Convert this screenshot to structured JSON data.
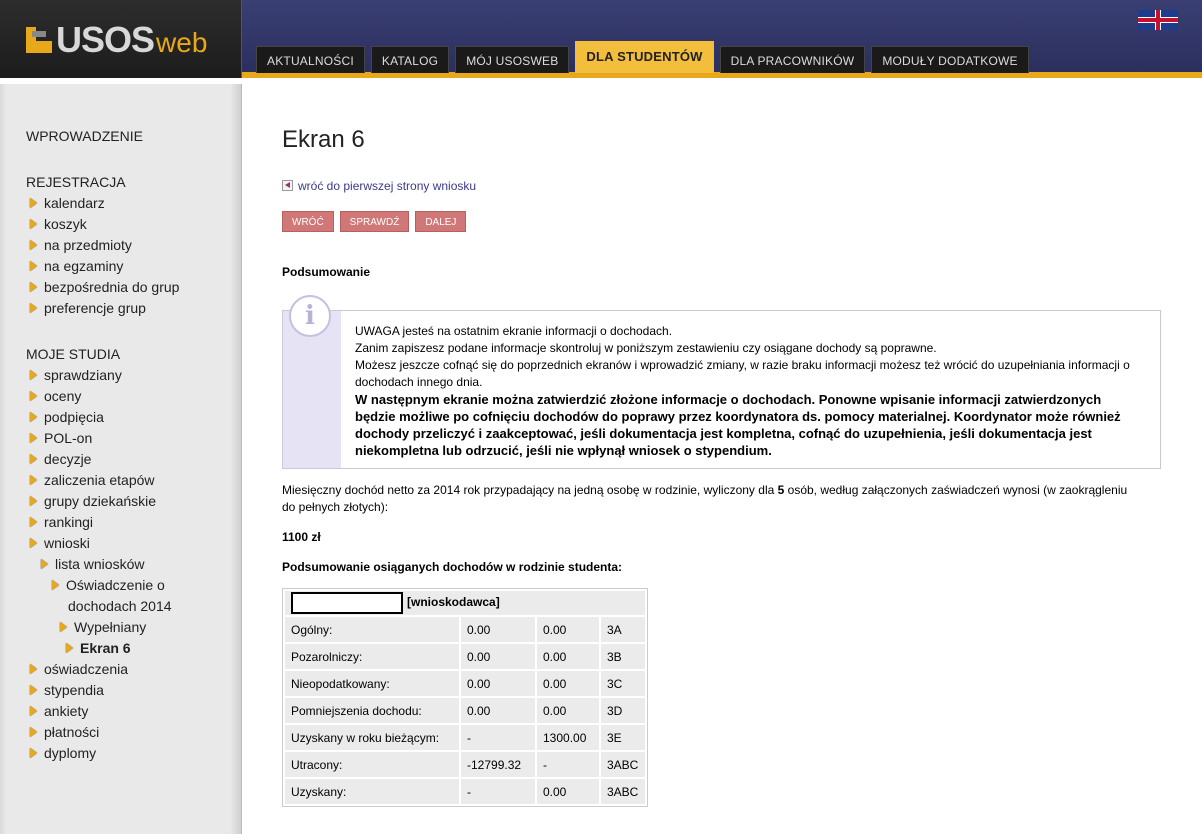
{
  "header": {
    "logo_main": "USOS",
    "logo_suffix": "web",
    "language_icon": "uk-flag-icon",
    "tabs": [
      {
        "label": "AKTUALNOŚCI",
        "active": false
      },
      {
        "label": "KATALOG",
        "active": false
      },
      {
        "label": "MÓJ USOSWEB",
        "active": false
      },
      {
        "label": "DLA STUDENTÓW",
        "active": true
      },
      {
        "label": "DLA PRACOWNIKÓW",
        "active": false
      },
      {
        "label": "MODUŁY DODATKOWE",
        "active": false
      }
    ]
  },
  "sidebar": {
    "sections": [
      "WPROWADZENIE",
      "REJESTRACJA",
      "MOJE STUDIA"
    ],
    "rejestracja": [
      "kalendarz",
      "koszyk",
      "na przedmioty",
      "na egzaminy",
      "bezpośrednia do grup",
      "preferencje grup"
    ],
    "studia": [
      "sprawdziany",
      "oceny",
      "podpięcia",
      "POL-on",
      "decyzje",
      "zaliczenia etapów",
      "grupy dziekańskie",
      "rankingi",
      "wnioski"
    ],
    "wnioski_sub": [
      "lista wniosków",
      "Oświadczenie o",
      "dochodach 2014",
      "Wypełniany",
      "Ekran 6"
    ],
    "studia_after": [
      "oświadczenia",
      "stypendia",
      "ankiety",
      "płatności",
      "dyplomy"
    ]
  },
  "main": {
    "title": "Ekran 6",
    "back_link": "wróć do pierwszej strony wniosku",
    "buttons": [
      "WRÓĆ",
      "SPRAWDŹ",
      "DALEJ"
    ],
    "summary_heading": "Podsumowanie",
    "notice": {
      "line1": "UWAGA jesteś na ostatnim ekranie informacji o dochodach.",
      "line2": "Zanim zapiszesz podane informacje skontroluj w poniższym zestawieniu czy osiągane dochody są poprawne.",
      "line3": "Możesz jeszcze cofnąć się do poprzednich ekranów i wprowadzić zmiany, w razie braku informacji możesz też wrócić do uzupełniania informacji o dochodach innego dnia.",
      "bold": "W następnym ekranie można zatwierdzić złożone informacje o dochodach. Ponowne wpisanie informacji zatwierdzonych będzie możliwe po cofnięciu dochodów do poprawy przez koordynatora ds. pomocy materialnej. Koordynator może również dochody przeliczyć i zaakceptować, jeśli dokumentacja jest kompletna, cofnąć do uzupełnienia, jeśli dokumentacja jest niekompletna lub odrzucić, jeśli nie wpłynął wniosek o stypendium."
    },
    "income_text_before": "Miesięczny dochód netto za 2014 rok przypadający na jedną osobę w rodzinie, wyliczony dla ",
    "income_persons": "5",
    "income_text_after": " osób, według załączonych zaświadczeń wynosi (w zaokrągleniu do pełnych złotych):",
    "income_value": "1100 zł",
    "family_heading": "Podsumowanie osiąganych dochodów w rodzinie studenta:",
    "applicant_label": "[wnioskodawca]",
    "table": [
      [
        "Ogólny:",
        "0.00",
        "0.00",
        "3A"
      ],
      [
        "Pozarolniczy:",
        "0.00",
        "0.00",
        "3B"
      ],
      [
        "Nieopodatkowany:",
        "0.00",
        "0.00",
        "3C"
      ],
      [
        "Pomniejszenia dochodu:",
        "0.00",
        "0.00",
        "3D"
      ],
      [
        "Uzyskany w roku bieżącym:",
        "-",
        "1300.00",
        "3E"
      ],
      [
        "Utracony:",
        "-12799.32",
        "-",
        "3ABC"
      ],
      [
        "Uzyskany:",
        "-",
        "0.00",
        "3ABC"
      ]
    ]
  }
}
